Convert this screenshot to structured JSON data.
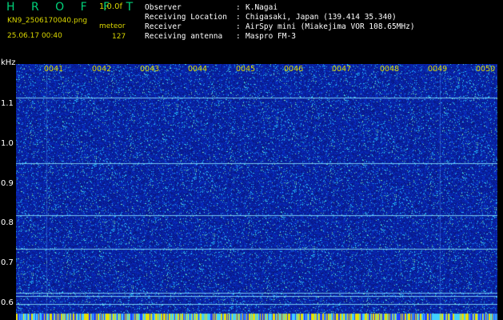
{
  "header": {
    "brand": "H R O F F T",
    "version": "1.0.0f",
    "filename": "KN9_2506170040.png",
    "datetime": "25.06.17 00:40",
    "mode": "meteor",
    "count": "127"
  },
  "info": [
    {
      "key": "Observer",
      "value": "K.Nagai"
    },
    {
      "key": "Receiving Location",
      "value": "Chigasaki, Japan (139.414 35.340)"
    },
    {
      "key": "Receiver",
      "value": "AirSpy mini (Miakejima VOR 108.65MHz)"
    },
    {
      "key": "Receiving antenna",
      "value": "Maspro FM-3"
    }
  ],
  "separator": ":",
  "axis": {
    "unit": "kHz",
    "y_labels": [
      "1.1",
      "1.0",
      "0.9",
      "0.8",
      "0.7",
      "0.6"
    ],
    "time_labels": [
      "0041",
      "0042",
      "0043",
      "0044",
      "0045",
      "0046",
      "0047",
      "0048",
      "0049",
      "0050"
    ]
  },
  "colors": {
    "background": "#000000",
    "waterfall_base": "#0a1aa0",
    "text_yellow": "#d9d600",
    "brand_green": "#00d27a"
  }
}
